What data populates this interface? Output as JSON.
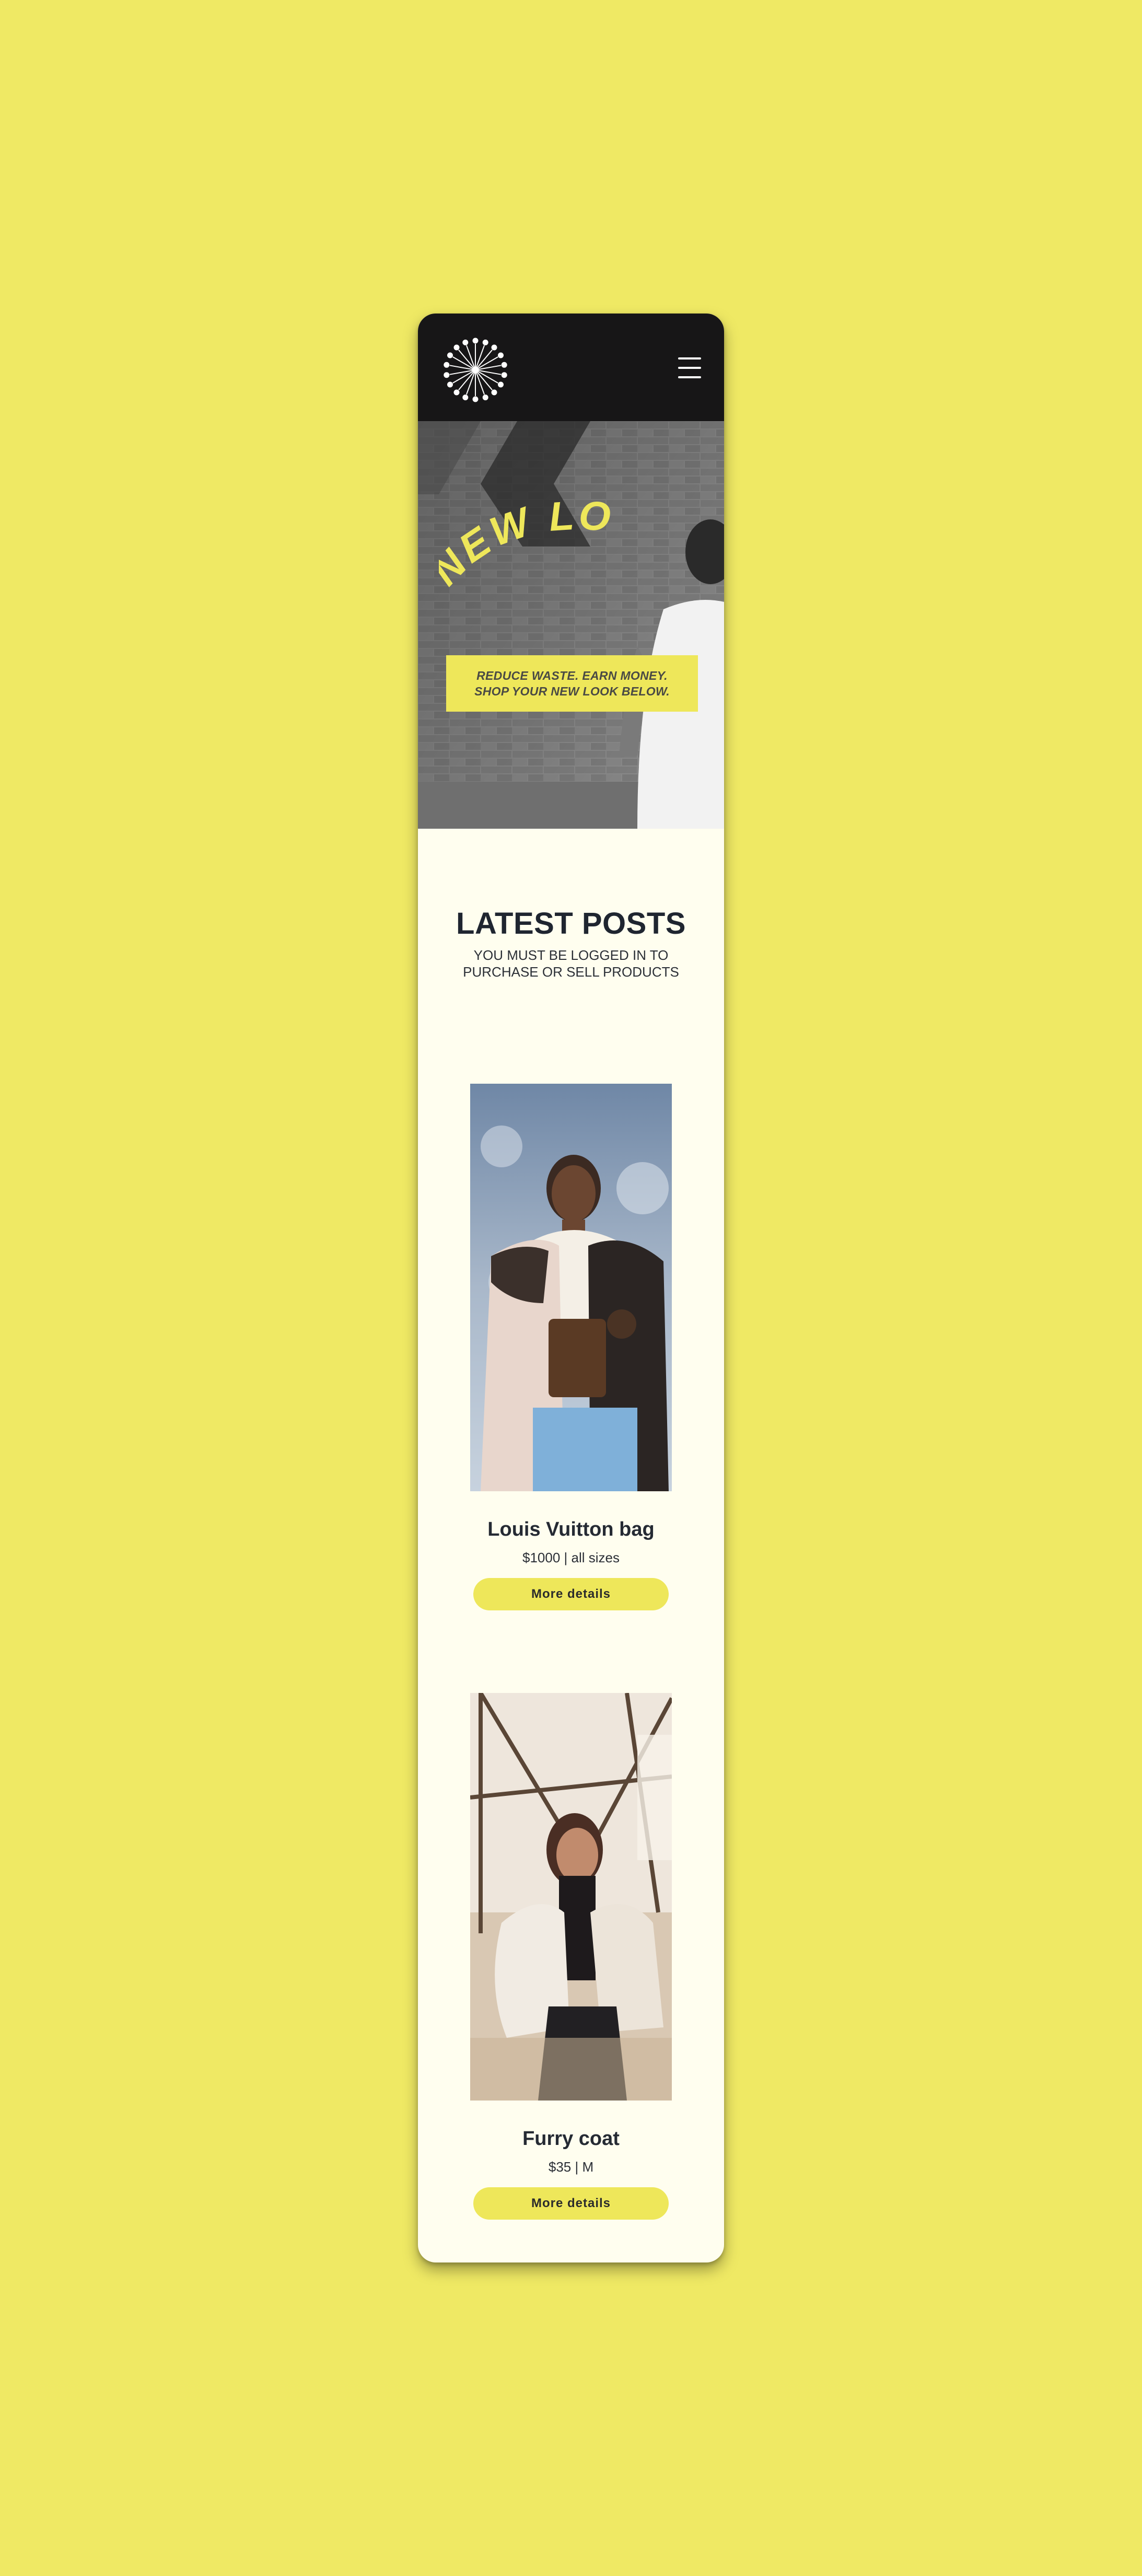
{
  "header": {
    "logo_icon": "sunburst-logo-icon",
    "menu_icon": "hamburger-menu-icon"
  },
  "hero": {
    "headline": "NEW LOOK",
    "banner_line1": "REDUCE WASTE. EARN MONEY.",
    "banner_line2": "SHOP YOUR NEW LOOK BELOW."
  },
  "latest": {
    "title": "LATEST POSTS",
    "subtitle_line1": "YOU MUST BE LOGGED IN TO",
    "subtitle_line2": "PURCHASE OR SELL PRODUCTS"
  },
  "posts": [
    {
      "title": "Louis Vuitton bag",
      "meta": "$1000 | all sizes",
      "button_label": "More details"
    },
    {
      "title": "Furry coat",
      "meta": "$35 | M",
      "button_label": "More details"
    }
  ],
  "colors": {
    "page_bg": "#efe964",
    "accent": "#eee75a",
    "header_bg": "#171617",
    "content_bg": "#fffeef"
  }
}
